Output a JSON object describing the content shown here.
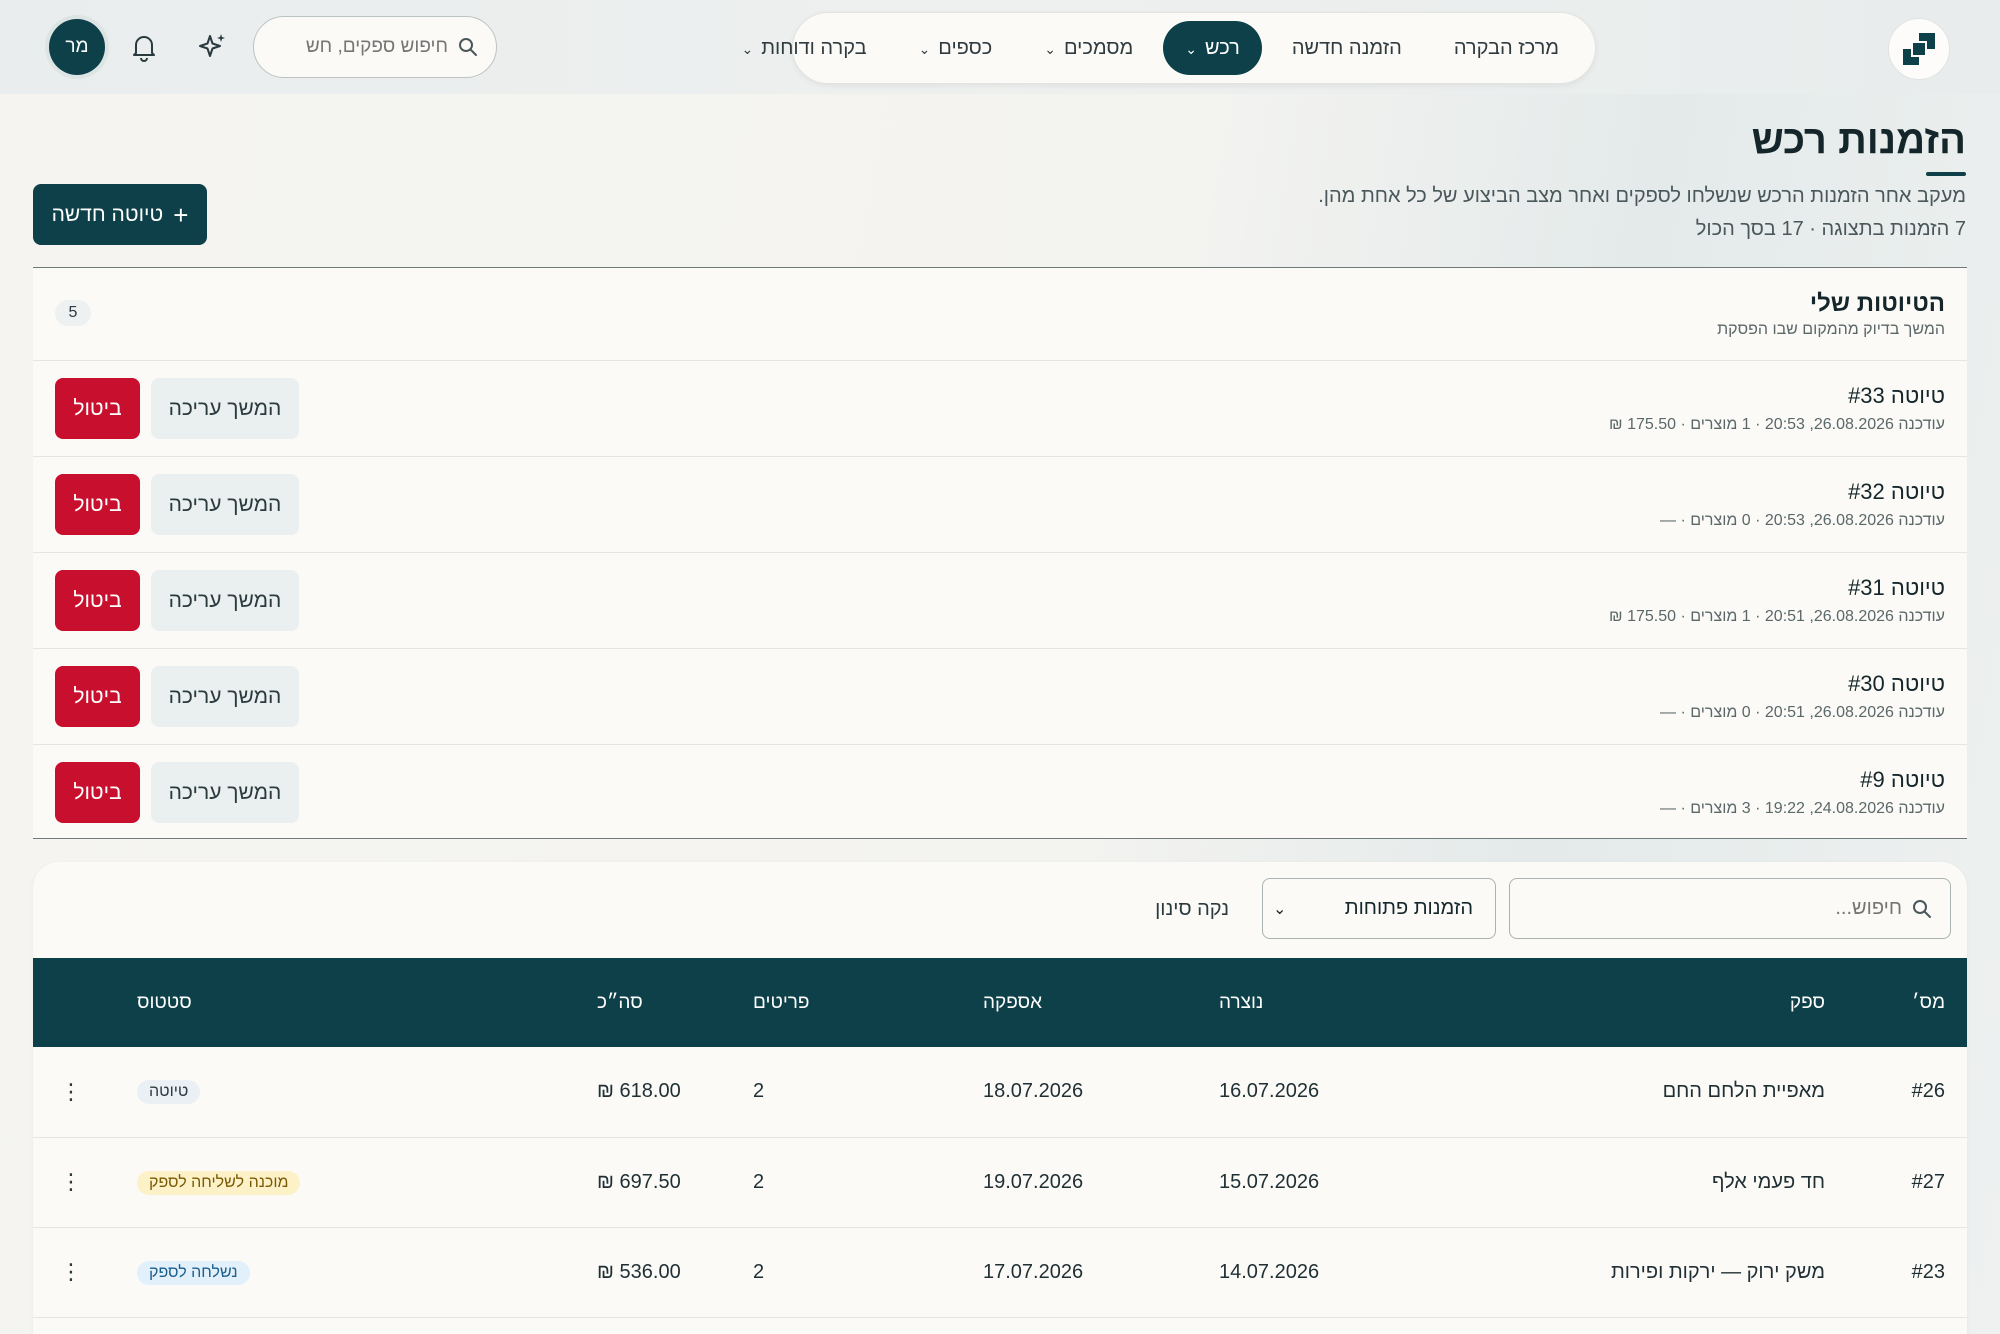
{
  "nav": {
    "items": [
      {
        "label": "מרכז הבקרה",
        "has_dropdown": false,
        "active": false
      },
      {
        "label": "הזמנה חדשה",
        "has_dropdown": false,
        "active": false
      },
      {
        "label": "רכש",
        "has_dropdown": true,
        "active": true
      },
      {
        "label": "מסמכים",
        "has_dropdown": true,
        "active": false
      },
      {
        "label": "כספים",
        "has_dropdown": true,
        "active": false
      },
      {
        "label": "בקרה ודוחות",
        "has_dropdown": true,
        "active": false
      }
    ]
  },
  "topbar": {
    "search_placeholder": "חיפוש ספקים, חש",
    "avatar_initials": "מר"
  },
  "page": {
    "title": "הזמנות רכש",
    "subtitle": "מעקב אחר הזמנות הרכש שנשלחו לספקים ואחר מצב הביצוע של כל אחת מהן.",
    "count_line": "7 הזמנות בתצוגה · 17 בסך הכול",
    "new_draft_label": "טיוטה חדשה"
  },
  "drafts": {
    "title": "הטיוטות שלי",
    "subtitle": "המשך בדיוק מהמקום שבו הפסקת",
    "count": "5",
    "edit_label": "המשך עריכה",
    "cancel_label": "ביטול",
    "items": [
      {
        "name": "טיוטה #33",
        "meta": "עודכנה 26.08.2026, 20:53 · 1 מוצרים · 175.50 ₪"
      },
      {
        "name": "טיוטה #32",
        "meta": "עודכנה 26.08.2026, 20:53 · 0 מוצרים · —"
      },
      {
        "name": "טיוטה #31",
        "meta": "עודכנה 26.08.2026, 20:51 · 1 מוצרים · 175.50 ₪"
      },
      {
        "name": "טיוטה #30",
        "meta": "עודכנה 26.08.2026, 20:51 · 0 מוצרים · —"
      },
      {
        "name": "טיוטה #9",
        "meta": "עודכנה 24.08.2026, 19:22 · 3 מוצרים · —"
      }
    ]
  },
  "orders": {
    "search_placeholder": "חיפוש...",
    "filter_selected": "הזמנות פתוחות",
    "clear_filter_label": "נקה סינון",
    "columns": [
      "מס׳",
      "ספק",
      "נוצרה",
      "אספקה",
      "פריטים",
      "סה״כ",
      "סטטוס"
    ],
    "rows": [
      {
        "id": "#26",
        "supplier": "מאפיית הלחם החם",
        "created": "16.07.2026",
        "delivery": "18.07.2026",
        "items": "2",
        "total": "618.00 ₪",
        "status": "טיוטה",
        "status_bg": "#eaf0f4",
        "status_fg": "#2b3a3e"
      },
      {
        "id": "#27",
        "supplier": "חד פעמי אלף",
        "created": "15.07.2026",
        "delivery": "19.07.2026",
        "items": "2",
        "total": "697.50 ₪",
        "status": "מוכנה לשליחה לספק",
        "status_bg": "#fdf1c7",
        "status_fg": "#7a5a06"
      },
      {
        "id": "#23",
        "supplier": "משק ירוק — ירקות ופירות",
        "created": "14.07.2026",
        "delivery": "17.07.2026",
        "items": "2",
        "total": "536.00 ₪",
        "status": "נשלחה לספק",
        "status_bg": "#e2f0fb",
        "status_fg": "#1b5f8c"
      }
    ]
  },
  "colors": {
    "primary": "#0d4049",
    "danger": "#c8102e",
    "background": "#f4f3f0",
    "card": "#fbfaf7"
  }
}
